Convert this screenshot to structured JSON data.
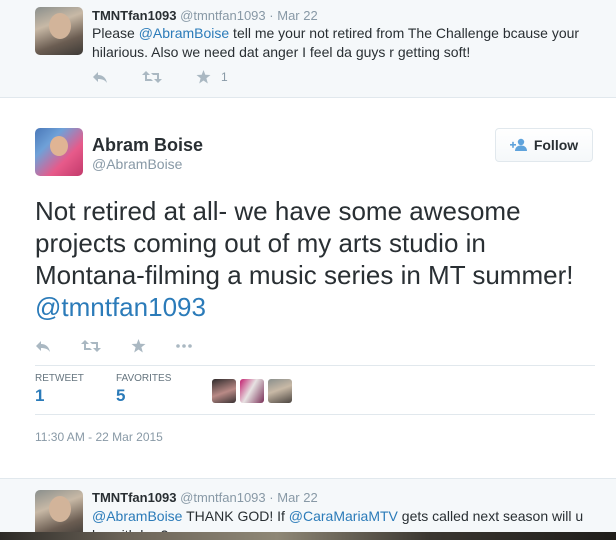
{
  "top_reply": {
    "name": "TMNTfan1093",
    "handle": "@tmntfan1093",
    "sep": "·",
    "date": "Mar 22",
    "text_pre": "Please ",
    "mention": "@AbramBoise",
    "text_post": " tell me your not retired from The Challenge bcause your hilarious. Also we need dat anger I feel da guys r getting soft!",
    "favorite_count": "1"
  },
  "main_tweet": {
    "name": "Abram Boise",
    "handle": "@AbramBoise",
    "follow_label": "Follow",
    "text": "Not retired at all- we have some awesome projects coming out of my arts studio in Montana-filming a music series in MT summer! ",
    "mention": "@tmntfan1093",
    "retweet_label": "RETWEET",
    "retweet_count": "1",
    "favorites_label": "FAVORITES",
    "favorites_count": "5",
    "timestamp": "11:30 AM - 22 Mar 2015"
  },
  "bottom_reply": {
    "name": "TMNTfan1093",
    "handle": "@tmntfan1093",
    "sep": "·",
    "date": "Mar 22",
    "mention1": "@AbramBoise",
    "text_mid": " THANK GOD! If ",
    "mention2": "@CaraMariaMTV",
    "text_post": " gets called next season will u be with her?"
  },
  "colors": {
    "link": "#2b7bb9",
    "muted": "#8899a6",
    "icon": "#aab8c2",
    "reply_bg": "#f5f8fa",
    "border": "#e1e8ed"
  },
  "icons": [
    "reply-icon",
    "retweet-icon",
    "favorite-icon",
    "more-icon",
    "follow-person-icon"
  ]
}
